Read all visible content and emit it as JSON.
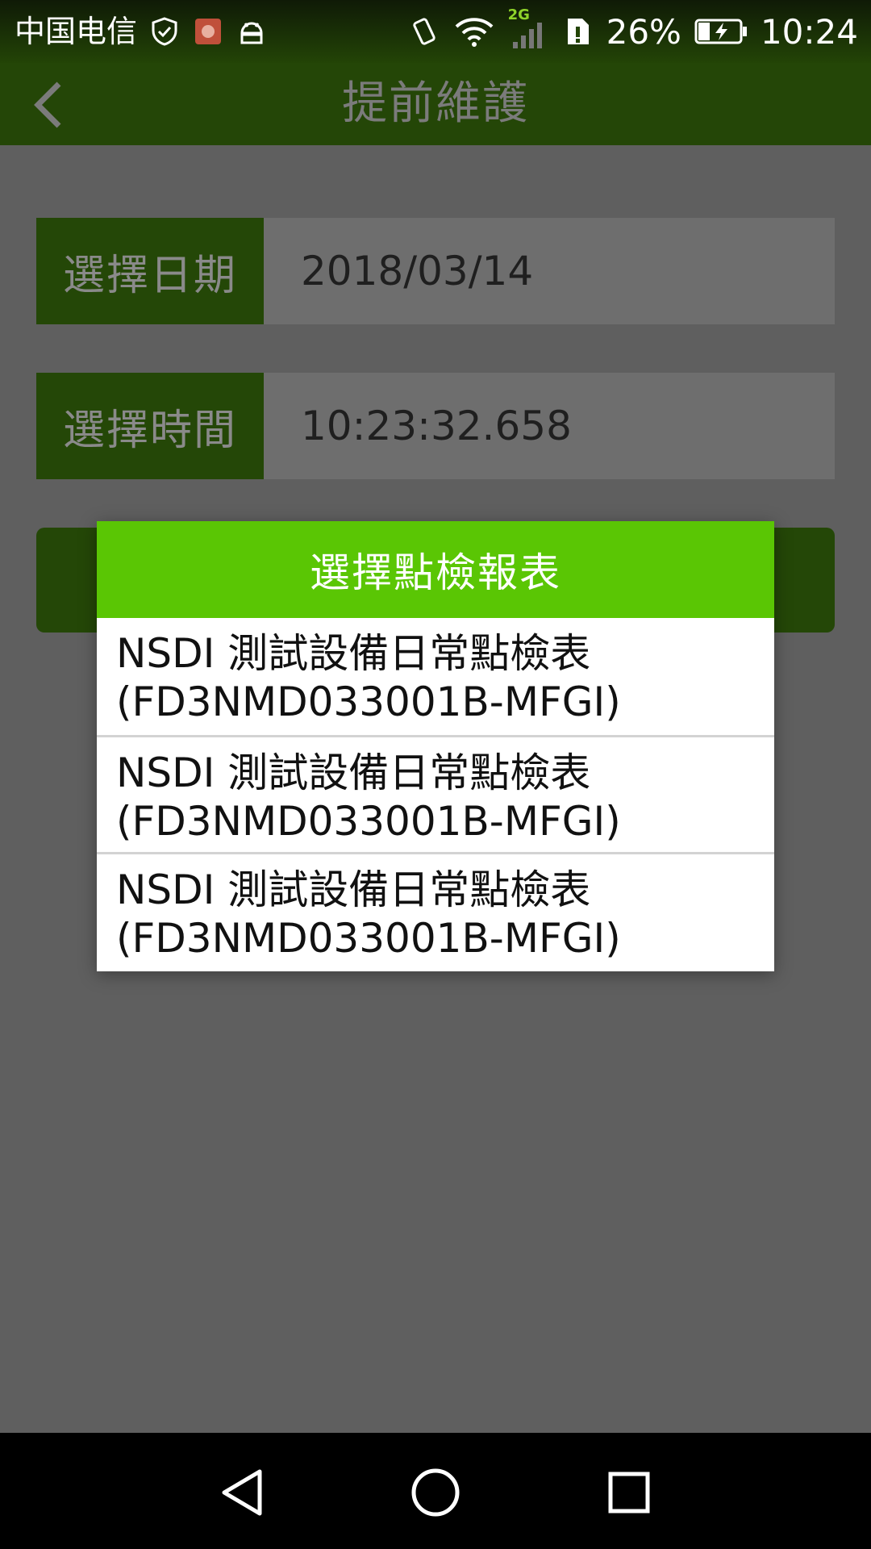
{
  "status_bar": {
    "carrier": "中国电信",
    "network_label": "2G",
    "battery_percent": "26%",
    "time": "10:24"
  },
  "app_bar": {
    "title": "提前維護"
  },
  "form": {
    "date_label": "選擇日期",
    "date_value": "2018/03/14",
    "time_label": "選擇時間",
    "time_value": "10:23:32.658"
  },
  "dialog": {
    "title": "選擇點檢報表",
    "items": [
      {
        "line1": "NSDI 測試設備日常點檢表",
        "line2": "(FD3NMD033001B-MFGI)"
      },
      {
        "line1": "NSDI 測試設備日常點檢表",
        "line2": "(FD3NMD033001B-MFGI)"
      },
      {
        "line1": "NSDI 測試設備日常點檢表",
        "line2": "(FD3NMD033001B-MFGI)"
      }
    ]
  },
  "colors": {
    "app_bar": "#244607",
    "dialog_header": "#5ac604",
    "scrim": "#5f5f5f"
  },
  "icons": [
    "shield-check-icon",
    "huawei-app-icon",
    "android-icon",
    "vibrate-icon",
    "wifi-icon",
    "signal-icon",
    "sim-alert-icon",
    "battery-charging-icon",
    "back-arrow-icon",
    "nav-back-icon",
    "nav-home-icon",
    "nav-recents-icon"
  ]
}
